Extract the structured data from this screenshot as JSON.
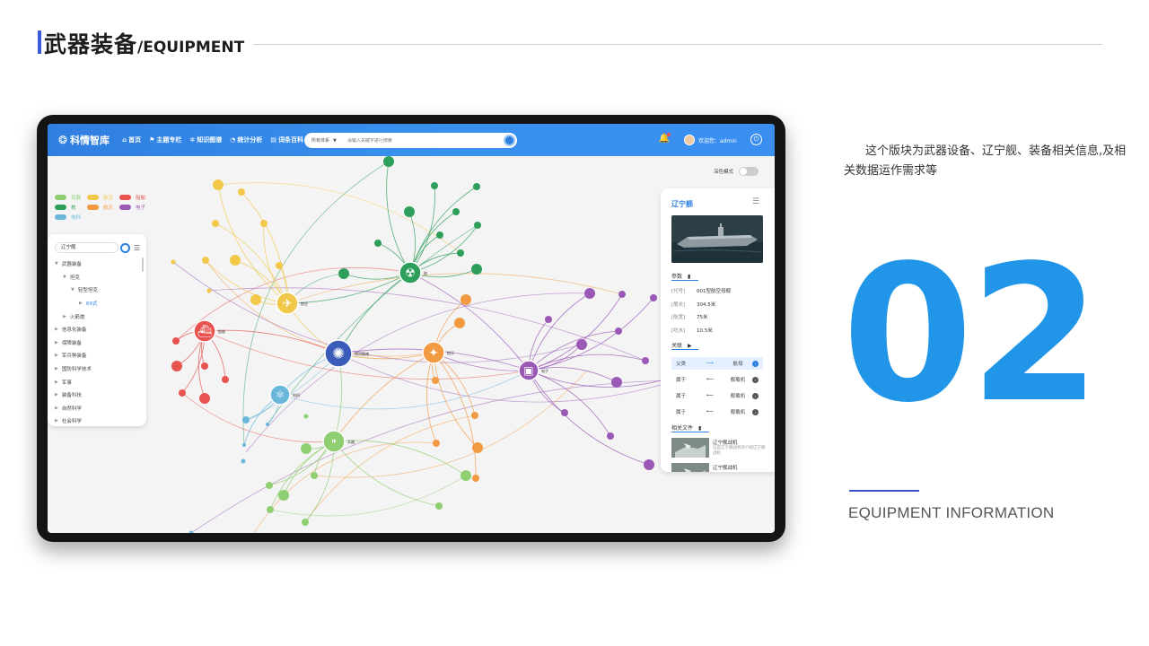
{
  "header": {
    "title_cn": "武器装备",
    "title_en": "/EQUIPMENT"
  },
  "app": {
    "logo": "科情智库",
    "nav": [
      "首页",
      "主题专栏",
      "知识图谱",
      "统计分析",
      "词条百科"
    ],
    "search_scope": "所有体系",
    "search_placeholder": "请输入关键字进行搜索",
    "user": "欢迎您：admin",
    "dark_mode": "深色模式"
  },
  "legend": [
    {
      "label": "兵器",
      "color": "#8fcf72"
    },
    {
      "label": "航空",
      "color": "#f2c84b"
    },
    {
      "label": "船舶",
      "color": "#e8524f"
    },
    {
      "label": "核",
      "color": "#2e9e5b"
    },
    {
      "label": "航天",
      "color": "#f29a42"
    },
    {
      "label": "电子",
      "color": "#9b59b6"
    },
    {
      "label": "电科",
      "color": "#6bb7db"
    }
  ],
  "tree": {
    "search_value": "辽宁舰",
    "items": [
      {
        "label": "武器装备",
        "indent": 0,
        "arrow": "▼"
      },
      {
        "label": "坦克",
        "indent": 1,
        "arrow": "▼"
      },
      {
        "label": "轻型坦克",
        "indent": 2,
        "arrow": "▼"
      },
      {
        "label": "69式",
        "indent": 3,
        "arrow": "▶",
        "active": true
      },
      {
        "label": "火箭炮",
        "indent": 1,
        "arrow": "▶"
      },
      {
        "label": "信息化装备",
        "indent": 0,
        "arrow": "▶"
      },
      {
        "label": "保障装备",
        "indent": 0,
        "arrow": "▶"
      },
      {
        "label": "军兵种装备",
        "indent": 0,
        "arrow": "▶"
      },
      {
        "label": "国防科学技术",
        "indent": 0,
        "arrow": "▶"
      },
      {
        "label": "军事",
        "indent": 0,
        "arrow": "▶"
      },
      {
        "label": "装备科技",
        "indent": 0,
        "arrow": "▶"
      },
      {
        "label": "自然科学",
        "indent": 0,
        "arrow": "▶"
      },
      {
        "label": "社会科学",
        "indent": 0,
        "arrow": "▶"
      }
    ]
  },
  "graph": {
    "hubs": [
      {
        "label": "知识图谱",
        "color": "#3b5bb8",
        "icon": "brain-icon"
      },
      {
        "label": "航空",
        "color": "#f2c84b",
        "icon": "plane-icon"
      },
      {
        "label": "船舶",
        "color": "#e8524f",
        "icon": "ship-icon"
      },
      {
        "label": "核",
        "color": "#2e9e5b",
        "icon": "radiation-icon"
      },
      {
        "label": "航天",
        "color": "#f29a42",
        "icon": "satellite-icon"
      },
      {
        "label": "电子",
        "color": "#9b59b6",
        "icon": "chip-icon"
      },
      {
        "label": "电科",
        "color": "#6bb7db",
        "icon": "atom-icon"
      },
      {
        "label": "兵器",
        "color": "#8fcf72",
        "icon": "bullet-icon"
      }
    ]
  },
  "detail": {
    "title": "辽宁舰",
    "params_label": "参数",
    "params": [
      {
        "k": "[代号]",
        "v": "001型航空母舰"
      },
      {
        "k": "[舰长]",
        "v": "304.5米"
      },
      {
        "k": "[航宽]",
        "v": "75米"
      },
      {
        "k": "[吃水]",
        "v": "10.5米"
      }
    ],
    "relations_label": "关联",
    "relations": [
      {
        "type": "父类",
        "arrow": "⟶",
        "target": "航母",
        "hl": true
      },
      {
        "type": "属于",
        "arrow": "⟵",
        "target": "舰载机",
        "hl": false
      },
      {
        "type": "属于",
        "arrow": "⟵",
        "target": "舰载机",
        "hl": false
      },
      {
        "type": "属于",
        "arrow": "⟵",
        "target": "舰载机",
        "hl": false
      }
    ],
    "docs_label": "相关文件",
    "docs": [
      {
        "title": "辽宁舰战机",
        "desc": "这是辽宁舰战机的介绍辽宁舰战机"
      },
      {
        "title": "辽宁舰战机",
        "desc": ""
      }
    ]
  },
  "side": {
    "description": "这个版块为武器设备、辽宁舰、装备相关信息,及相关数据运作需求等",
    "number": "02",
    "info": "EQUIPMENT INFORMATION"
  }
}
